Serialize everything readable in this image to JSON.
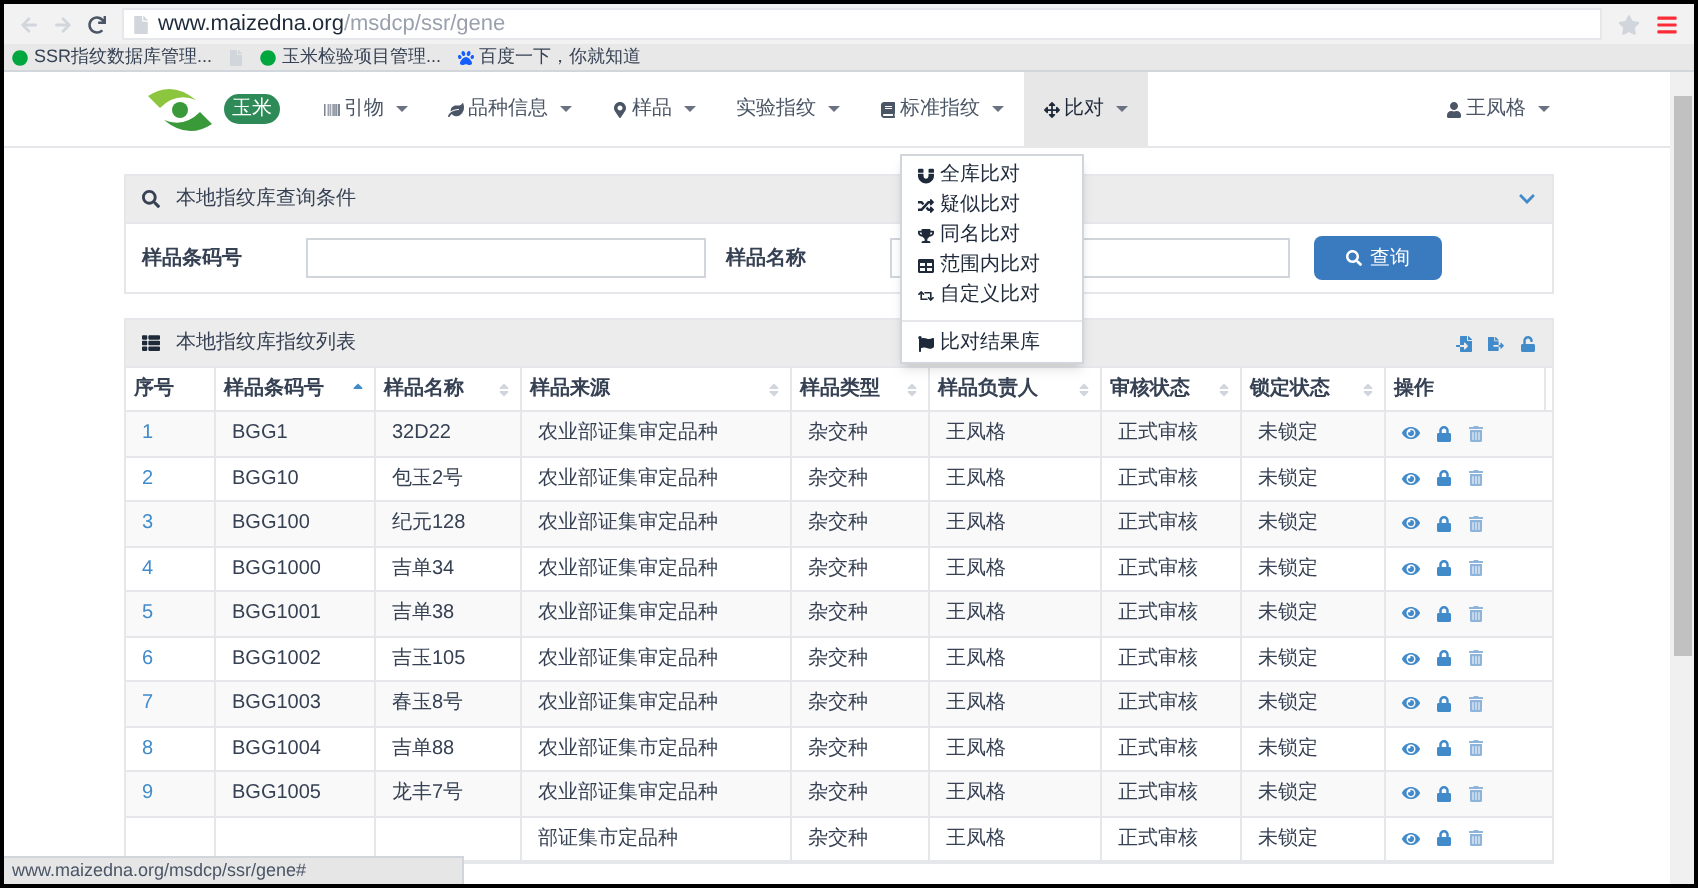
{
  "browser": {
    "url_host": "www.maizedna.org",
    "url_path": "/msdcp/ssr/gene",
    "bookmarks": [
      {
        "kind": "green",
        "label": "SSR指纹数据库管理..."
      },
      {
        "kind": "page"
      },
      {
        "kind": "green",
        "label": "玉米检验项目管理..."
      },
      {
        "kind": "paw",
        "label": "百度一下，你就知道"
      }
    ],
    "status_url": "www.maizedna.org/msdcp/ssr/gene#"
  },
  "navbar": {
    "badge": "玉米",
    "items": [
      {
        "label": "引物",
        "expanded": false
      },
      {
        "label": "品种信息",
        "expanded": false
      },
      {
        "label": "样品",
        "expanded": false
      },
      {
        "label": "实验指纹",
        "expanded": false
      },
      {
        "label": "标准指纹",
        "expanded": false
      },
      {
        "label": "比对",
        "expanded": true
      }
    ],
    "user": "王凤格"
  },
  "compare_menu": {
    "groups": [
      [
        {
          "label": "全库比对"
        },
        {
          "label": "疑似比对"
        },
        {
          "label": "同名比对"
        },
        {
          "label": "范围内比对"
        },
        {
          "label": "自定义比对"
        }
      ],
      [
        {
          "label": "比对结果库"
        }
      ]
    ]
  },
  "query_panel": {
    "title": "本地指纹库查询条件",
    "fields": [
      {
        "label": "样品条码号"
      },
      {
        "label": "样品名称"
      }
    ],
    "search_button": "查询"
  },
  "list_panel": {
    "title": "本地指纹库指纹列表",
    "columns": [
      {
        "label": "序号",
        "kind": "plain"
      },
      {
        "label": "样品条码号",
        "kind": "sorted"
      },
      {
        "label": "样品名称",
        "kind": "sortable"
      },
      {
        "label": "样品来源",
        "kind": "sortable"
      },
      {
        "label": "样品类型",
        "kind": "sortable"
      },
      {
        "label": "样品负责人",
        "kind": "sortable"
      },
      {
        "label": "审核状态",
        "kind": "sortable"
      },
      {
        "label": "锁定状态",
        "kind": "sortable"
      },
      {
        "label": "操作",
        "kind": "plain"
      }
    ],
    "rows": [
      {
        "no": "1",
        "code": "BGG1",
        "name": "32D22",
        "source": "农业部证集审定品种",
        "type": "杂交种",
        "owner": "王凤格",
        "review": "正式审核",
        "lock": "未锁定"
      },
      {
        "no": "2",
        "code": "BGG10",
        "name": "包玉2号",
        "source": "农业部证集审定品种",
        "type": "杂交种",
        "owner": "王凤格",
        "review": "正式审核",
        "lock": "未锁定"
      },
      {
        "no": "3",
        "code": "BGG100",
        "name": "纪元128",
        "source": "农业部证集审定品种",
        "type": "杂交种",
        "owner": "王凤格",
        "review": "正式审核",
        "lock": "未锁定"
      },
      {
        "no": "4",
        "code": "BGG1000",
        "name": "吉单34",
        "source": "农业部证集审定品种",
        "type": "杂交种",
        "owner": "王凤格",
        "review": "正式审核",
        "lock": "未锁定"
      },
      {
        "no": "5",
        "code": "BGG1001",
        "name": "吉单38",
        "source": "农业部证集审定品种",
        "type": "杂交种",
        "owner": "王凤格",
        "review": "正式审核",
        "lock": "未锁定"
      },
      {
        "no": "6",
        "code": "BGG1002",
        "name": "吉玉105",
        "source": "农业部证集审定品种",
        "type": "杂交种",
        "owner": "王凤格",
        "review": "正式审核",
        "lock": "未锁定"
      },
      {
        "no": "7",
        "code": "BGG1003",
        "name": "春玉8号",
        "source": "农业部证集审定品种",
        "type": "杂交种",
        "owner": "王凤格",
        "review": "正式审核",
        "lock": "未锁定"
      },
      {
        "no": "8",
        "code": "BGG1004",
        "name": "吉单88",
        "source": "农业部证集市定品种",
        "type": "杂交种",
        "owner": "王凤格",
        "review": "正式审核",
        "lock": "未锁定"
      },
      {
        "no": "9",
        "code": "BGG1005",
        "name": "龙丰7号",
        "source": "农业部证集审定品种",
        "type": "杂交种",
        "owner": "王凤格",
        "review": "正式审核",
        "lock": "未锁定"
      },
      {
        "source": "部证集市定品种",
        "type": "杂交种",
        "owner": "王凤格",
        "review": "正式审核",
        "lock": "未锁定"
      }
    ]
  }
}
